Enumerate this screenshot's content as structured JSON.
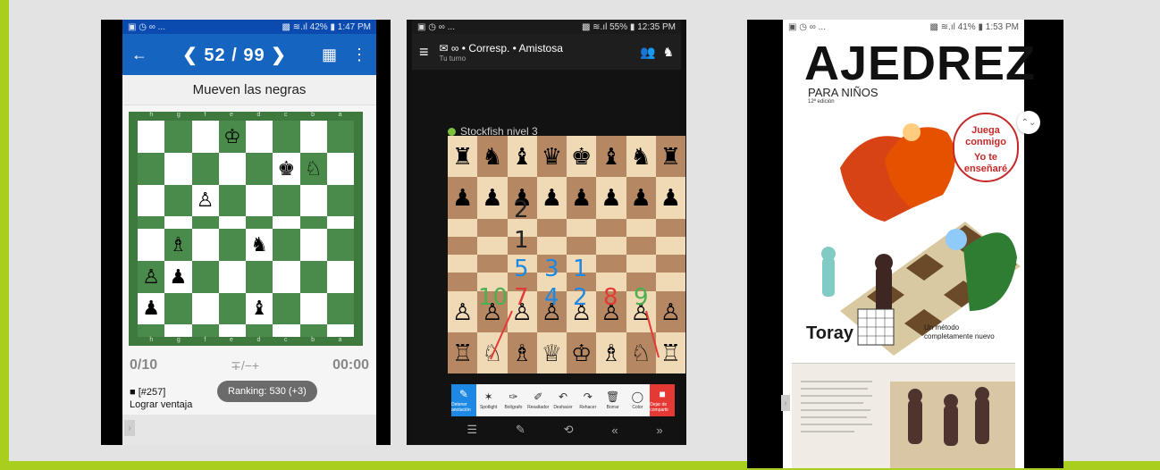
{
  "colors": {
    "accent": "#a8cf1e",
    "p1_primary": "#1565c0",
    "board_green": "#4a8a4a",
    "board_tan_light": "#f0d9b5",
    "board_tan_dark": "#b58863",
    "toolbar_active": "#1e88e5",
    "toolbar_stop": "#e53935",
    "bubble_red": "#c62828"
  },
  "phone1": {
    "status_left": "▣ ◷ ∞ ...",
    "status_right": "▩ ≋.ıl 42% ▮ 1:47 PM",
    "back_icon": "←",
    "counter": "❮  52 / 99  ❯",
    "grid_icon": "▦",
    "menu_icon": "⋮",
    "subtitle": "Mueven las negras",
    "files": [
      "h",
      "g",
      "f",
      "e",
      "d",
      "c",
      "b",
      "a"
    ],
    "score": "0/10",
    "eval": "∓/−+",
    "timer": "00:00",
    "task_id": "■ [#257]",
    "task_text": "Lograr ventaja",
    "ranking": "Ranking: 530 (+3)",
    "left_nav": "›",
    "board": [
      [
        "",
        "",
        "",
        "♔",
        "",
        "",
        "",
        ""
      ],
      [
        "",
        "",
        "",
        "",
        "",
        "♚",
        "♘",
        ""
      ],
      [
        "",
        "",
        "♙",
        "",
        "",
        "",
        "",
        ""
      ],
      [
        "",
        "",
        "",
        "",
        "",
        "",
        "",
        ""
      ],
      [
        "",
        "♗",
        "",
        "",
        "♞",
        "",
        "",
        ""
      ],
      [
        "♙",
        "♟",
        "",
        "",
        "",
        "",
        "",
        ""
      ],
      [
        "♟",
        "",
        "",
        "",
        "♝",
        "",
        "",
        ""
      ],
      [
        "",
        "",
        "",
        "",
        "",
        "",
        "",
        ""
      ]
    ]
  },
  "phone2": {
    "status_left": "▣ ◷ ∞ ...",
    "status_right": "▩ ≋.ıl 55% ▮ 12:35 PM",
    "menu_icon": "≡",
    "title": "✉ ∞ • Corresp. • Amistosa",
    "turn": "Tu turno",
    "icons": [
      "👥",
      "♞"
    ],
    "opponent": "Stockfish nivel 3",
    "board": [
      [
        "♜",
        "♞",
        "♝",
        "♛",
        "♚",
        "♝",
        "♞",
        "♜"
      ],
      [
        "♟",
        "♟",
        "♟",
        "♟",
        "♟",
        "♟",
        "♟",
        "♟"
      ],
      [
        "",
        "",
        "",
        "",
        "",
        "",
        "",
        ""
      ],
      [
        "",
        "",
        "",
        "",
        "",
        "",
        "",
        ""
      ],
      [
        "",
        "",
        "",
        "",
        "",
        "",
        "",
        ""
      ],
      [
        "",
        "",
        "",
        "",
        "",
        "",
        "",
        ""
      ],
      [
        "♙",
        "♙",
        "♙",
        "♙",
        "♙",
        "♙",
        "♙",
        "♙"
      ],
      [
        "♖",
        "♘",
        "♗",
        "♕",
        "♔",
        "♗",
        "♘",
        "♖"
      ]
    ],
    "annotations": [
      "2",
      "1",
      "5",
      "3",
      "1",
      "10",
      "7",
      "4",
      "2",
      "8",
      "9"
    ],
    "tools": [
      {
        "icon": "✎",
        "label": "Detener anotación"
      },
      {
        "icon": "✶",
        "label": "Spotlight"
      },
      {
        "icon": "✑",
        "label": "Bolígrafo"
      },
      {
        "icon": "✐",
        "label": "Resaltador"
      },
      {
        "icon": "↶",
        "label": "Deshacer"
      },
      {
        "icon": "↷",
        "label": "Rehacer"
      },
      {
        "icon": "🗑",
        "label": "Borrar"
      },
      {
        "icon": "◯",
        "label": "Color"
      },
      {
        "icon": "■",
        "label": "Dejar de compartir"
      }
    ],
    "nav_icons": [
      "☰",
      "✎",
      "⟲",
      "«",
      "»"
    ]
  },
  "phone3": {
    "status_left": "▣ ◷ ∞ ...",
    "status_right": "▩ ≋.ıl 41% ▮ 1:53 PM",
    "title": "AJEDREZ",
    "subtitle": "PARA NIÑOS",
    "edition": "12ª edición",
    "bubble": [
      "Juega",
      "conmigo",
      "Yo te",
      "enseñaré"
    ],
    "publisher": "Toray",
    "tagline_1": "Un método",
    "tagline_2": "completamente nuevo",
    "side_button": "⌃⌄",
    "left_nav": "›"
  }
}
